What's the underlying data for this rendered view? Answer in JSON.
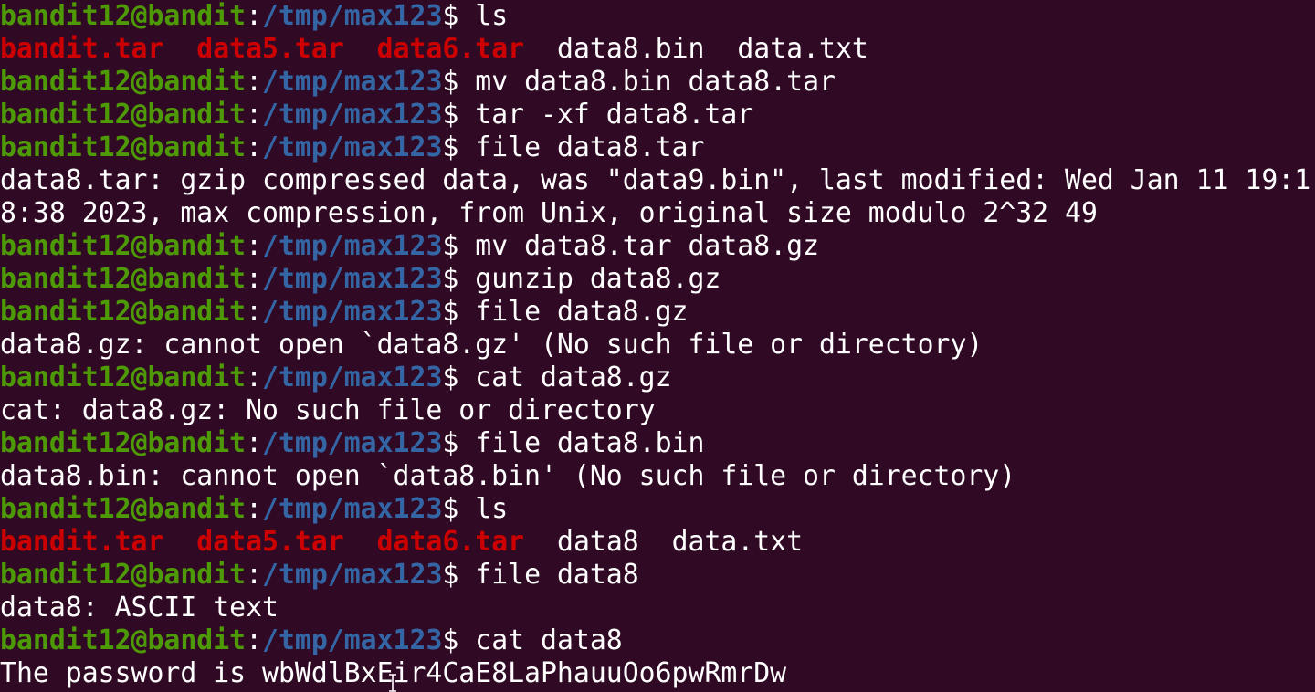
{
  "prompt": {
    "user_host": "bandit12@bandit",
    "colon": ":",
    "path": "/tmp/max123",
    "dollar": "$"
  },
  "colors": {
    "background": "#300a24",
    "user_host": "#4e9a06",
    "path": "#3465a4",
    "archive": "#cc0000",
    "text": "#ffffff"
  },
  "lines": [
    {
      "kind": "prompt",
      "cmd": " ls"
    },
    {
      "kind": "listing",
      "items": [
        {
          "text": "bandit.tar",
          "archive": true
        },
        {
          "text": "  ",
          "archive": false
        },
        {
          "text": "data5.tar",
          "archive": true
        },
        {
          "text": "  ",
          "archive": false
        },
        {
          "text": "data6.tar",
          "archive": true
        },
        {
          "text": "  data8.bin  data.txt",
          "archive": false
        }
      ]
    },
    {
      "kind": "prompt",
      "cmd": " mv data8.bin data8.tar"
    },
    {
      "kind": "prompt",
      "cmd": " tar -xf data8.tar"
    },
    {
      "kind": "prompt",
      "cmd": " file data8.tar"
    },
    {
      "kind": "output",
      "text": "data8.tar: gzip compressed data, was \"data9.bin\", last modified: Wed Jan 11 19:1"
    },
    {
      "kind": "output",
      "text": "8:38 2023, max compression, from Unix, original size modulo 2^32 49"
    },
    {
      "kind": "prompt",
      "cmd": " mv data8.tar data8.gz"
    },
    {
      "kind": "prompt",
      "cmd": " gunzip data8.gz"
    },
    {
      "kind": "prompt",
      "cmd": " file data8.gz"
    },
    {
      "kind": "output",
      "text": "data8.gz: cannot open `data8.gz' (No such file or directory)"
    },
    {
      "kind": "prompt",
      "cmd": " cat data8.gz"
    },
    {
      "kind": "output",
      "text": "cat: data8.gz: No such file or directory"
    },
    {
      "kind": "prompt",
      "cmd": " file data8.bin"
    },
    {
      "kind": "output",
      "text": "data8.bin: cannot open `data8.bin' (No such file or directory)"
    },
    {
      "kind": "prompt",
      "cmd": " ls"
    },
    {
      "kind": "listing",
      "items": [
        {
          "text": "bandit.tar",
          "archive": true
        },
        {
          "text": "  ",
          "archive": false
        },
        {
          "text": "data5.tar",
          "archive": true
        },
        {
          "text": "  ",
          "archive": false
        },
        {
          "text": "data6.tar",
          "archive": true
        },
        {
          "text": "  data8  data.txt",
          "archive": false
        }
      ]
    },
    {
      "kind": "prompt",
      "cmd": " file data8"
    },
    {
      "kind": "output",
      "text": "data8: ASCII text"
    },
    {
      "kind": "prompt",
      "cmd": " cat data8"
    },
    {
      "kind": "output",
      "text": "The password is wbWdlBxEir4CaE8LaPhauuOo6pwRmrDw"
    }
  ]
}
